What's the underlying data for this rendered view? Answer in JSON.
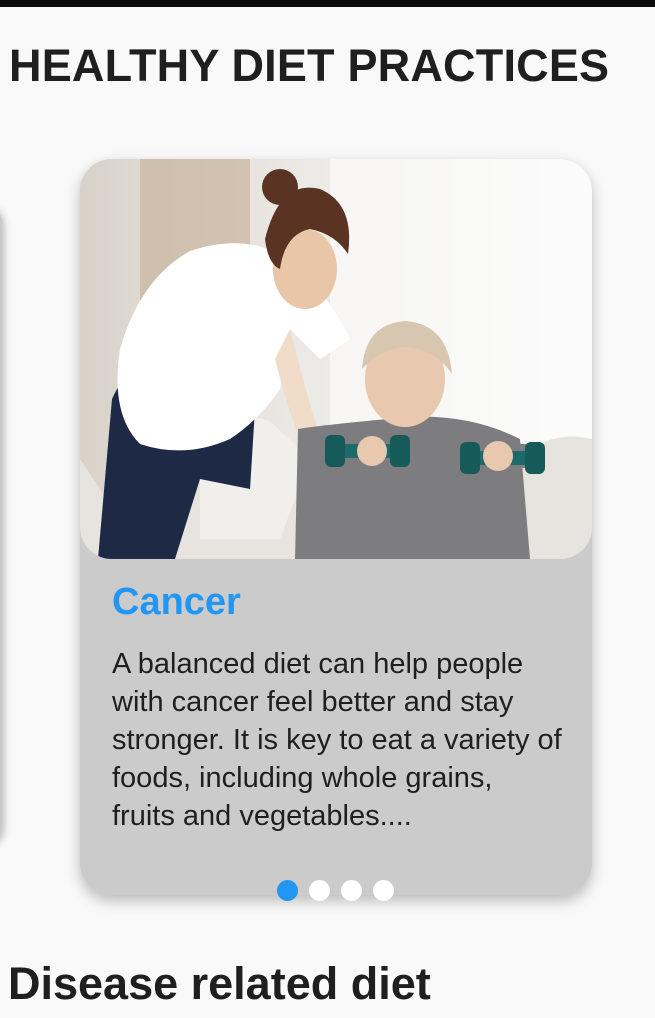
{
  "page": {
    "section_title": "HEALTHY DIET PRACTICES",
    "disease_title": "Disease related diet"
  },
  "carousel": {
    "active_index": 0,
    "slide_count": 4,
    "active_slide": {
      "image": "caregiver-helping-elderly-woman-lift-dumbbells",
      "title": "Cancer",
      "description": "A balanced diet can help people with cancer feel better and stay stronger. It is key to eat a variety of foods, including whole grains, fruits and vegetables...."
    }
  },
  "colors": {
    "accent": "#2196f3",
    "card_background": "#cbcbcb",
    "page_background": "#f9f9f9",
    "dot_inactive": "#ffffff"
  }
}
